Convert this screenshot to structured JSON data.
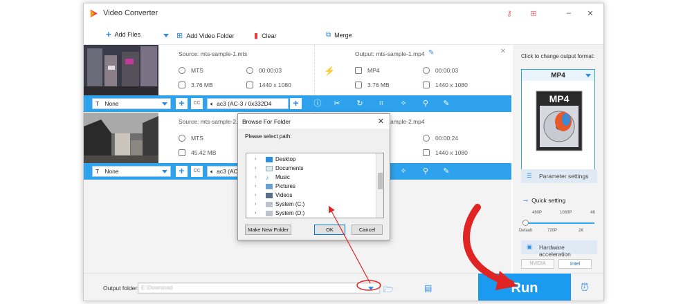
{
  "app": {
    "title": "Video Converter"
  },
  "toolbar": {
    "add_files": "Add Files",
    "add_video_folder": "Add Video Folder",
    "clear": "Clear",
    "merge": "Merge"
  },
  "items": [
    {
      "source": "Source: mts-sample-1.mts",
      "src_format": "MTS",
      "src_duration": "00:00:03",
      "src_size": "3.76 MB",
      "src_res": "1440 x 1080",
      "output": "Output: mts-sample-1.mp4",
      "out_format": "MP4",
      "out_duration": "00:00:03",
      "out_size": "3.76 MB",
      "out_res": "1440 x 1080",
      "subtitle": "None",
      "audio": "ac3 (AC-3 / 0x332D4"
    },
    {
      "source": "Source: mts-sample-2.mts",
      "src_format": "MTS",
      "src_size": "45.42 MB",
      "output": "Output: mts-sample-2.mp4",
      "out_duration": "00:00:24",
      "out_res": "1440 x 1080",
      "subtitle": "None",
      "audio": "ac3 (AC-3 / 0x332D4"
    }
  ],
  "right": {
    "change_format": "Click to change output format:",
    "format": "MP4",
    "format_icon_label": "MP4",
    "param_settings": "Parameter settings",
    "quick_setting": "Quick setting",
    "slider_top": [
      "480P",
      "1080P",
      "4K"
    ],
    "slider_bottom": [
      "Default",
      "720P",
      "2K"
    ],
    "hw_accel": "Hardware acceleration",
    "nvidia": "NVIDIA",
    "intel": "Intel"
  },
  "bottom": {
    "output_folder_label": "Output folder:",
    "output_folder_value": "E:\\Download",
    "run": "Run"
  },
  "dialog": {
    "title": "Browse For Folder",
    "prompt": "Please select path:",
    "tree": [
      "Desktop",
      "Documents",
      "Music",
      "Pictures",
      "Videos",
      "System (C:)",
      "System (D:)"
    ],
    "new_folder": "Make New Folder",
    "ok": "OK",
    "cancel": "Cancel"
  },
  "colors": {
    "accent": "#2ea2ec",
    "run": "#1b9bf0",
    "annotation": "#e02424"
  }
}
